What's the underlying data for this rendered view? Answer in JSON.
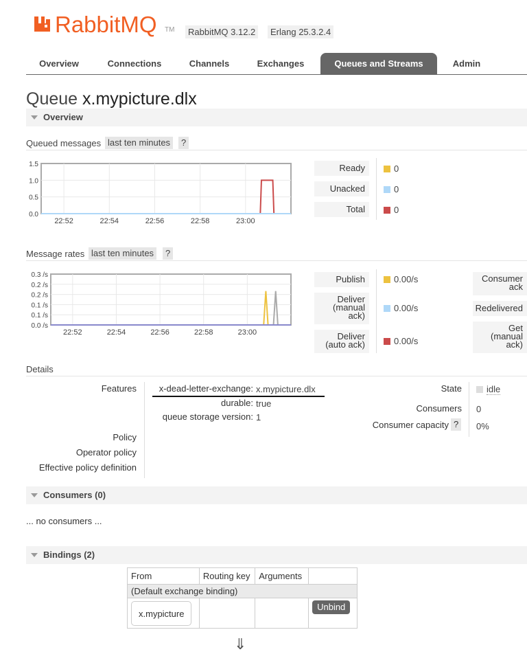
{
  "header": {
    "logo_text": "RabbitMQ",
    "logo_tm": "TM",
    "rabbitmq_version": "RabbitMQ 3.12.2",
    "erlang_version": "Erlang 25.3.2.4",
    "brand_color": "#f15f23"
  },
  "tabs": [
    {
      "label": "Overview"
    },
    {
      "label": "Connections"
    },
    {
      "label": "Channels"
    },
    {
      "label": "Exchanges"
    },
    {
      "label": "Queues and Streams",
      "active": true
    },
    {
      "label": "Admin"
    }
  ],
  "page": {
    "title_prefix": "Queue",
    "queue_name": "x.mypicture.dlx"
  },
  "overview_section": {
    "label": "Overview"
  },
  "queued_messages": {
    "label": "Queued messages",
    "range": "last ten minutes",
    "help": "?",
    "legend": [
      {
        "label": "Ready",
        "value": "0",
        "color": "#edc240"
      },
      {
        "label": "Unacked",
        "value": "0",
        "color": "#afd8f8"
      },
      {
        "label": "Total",
        "value": "0",
        "color": "#cb4b4b"
      }
    ]
  },
  "message_rates": {
    "label": "Message rates",
    "range": "last ten minutes",
    "help": "?",
    "legend": [
      {
        "label": "Publish",
        "value": "0.00/s",
        "color": "#edc240"
      },
      {
        "label": "Deliver (manual ack)",
        "lines": [
          "Deliver",
          "(manual",
          "ack)"
        ],
        "value": "0.00/s",
        "color": "#afd8f8"
      },
      {
        "label": "Deliver (auto ack)",
        "lines": [
          "Deliver",
          "(auto ack)"
        ],
        "value": "0.00/s",
        "color": "#cb4b4b"
      }
    ],
    "legend_right": [
      {
        "label": "Consumer ack",
        "lines": [
          "Consumer",
          "ack"
        ]
      },
      {
        "label": "Redelivered",
        "lines": [
          "Redelivered"
        ]
      },
      {
        "label": "Get (manual ack)",
        "lines": [
          "Get",
          "(manual",
          "ack)"
        ]
      }
    ]
  },
  "chart_data": [
    {
      "type": "line",
      "x_ticks": [
        "22:52",
        "22:54",
        "22:56",
        "22:58",
        "23:00"
      ],
      "y_ticks": [
        "0.0",
        "0.5",
        "1.0",
        "1.5"
      ],
      "ylim": [
        0,
        1.5
      ],
      "grid": true,
      "x_minutes": [
        0,
        9.65,
        9.7,
        10.2,
        10.25,
        11
      ],
      "series": [
        {
          "name": "Total",
          "color": "#cb4b4b",
          "values": [
            0,
            0,
            1,
            1,
            0,
            0
          ]
        },
        {
          "name": "Unacked",
          "color": "#afd8f8",
          "values": [
            0,
            0,
            0,
            0,
            0,
            0
          ]
        }
      ]
    },
    {
      "type": "line",
      "x_ticks": [
        "22:52",
        "22:54",
        "22:56",
        "22:58",
        "23:00"
      ],
      "y_ticks": [
        "0.0 /s",
        "0.1 /s",
        "0.1 /s",
        "0.2 /s",
        "0.2 /s",
        "0.3 /s"
      ],
      "ylim": [
        0,
        0.3
      ],
      "grid": true,
      "x_minutes": [
        0,
        9.75,
        9.85,
        9.95,
        10.2,
        10.3,
        10.4,
        11
      ],
      "series": [
        {
          "name": "Publish",
          "color": "#edc240",
          "values": [
            0,
            0,
            0.2,
            0,
            0,
            0,
            0,
            0
          ]
        },
        {
          "name": "Deliver (manual ack)",
          "color": "#aaaaaa",
          "values": [
            0,
            0,
            0,
            0,
            0,
            0.2,
            0,
            0
          ]
        },
        {
          "name": "Deliver (auto ack)",
          "color": "#8888cc",
          "values": [
            0,
            0,
            0,
            0,
            0,
            0,
            0,
            0
          ]
        }
      ]
    }
  ],
  "details": {
    "label": "Details",
    "features_label": "Features",
    "features": [
      {
        "key": "x-dead-letter-exchange:",
        "value": "x.mypicture.dlx"
      },
      {
        "key": "durable:",
        "value": "true"
      },
      {
        "key": "queue storage version:",
        "value": "1"
      }
    ],
    "policy_label": "Policy",
    "operator_policy_label": "Operator policy",
    "effective_policy_label": "Effective policy definition",
    "state_label": "State",
    "state_value": "idle",
    "consumers_label": "Consumers",
    "consumers_value": "0",
    "consumer_capacity_label": "Consumer capacity",
    "consumer_capacity_help": "?",
    "consumer_capacity_value": "0%"
  },
  "consumers_section": {
    "label": "Consumers (0)",
    "empty_text": "... no consumers ..."
  },
  "bindings_section": {
    "label": "Bindings (2)",
    "columns": [
      "From",
      "Routing key",
      "Arguments"
    ],
    "default_binding": "(Default exchange binding)",
    "source_exchange": "x.mypicture",
    "unbind_label": "Unbind",
    "arrow": "⇓"
  }
}
